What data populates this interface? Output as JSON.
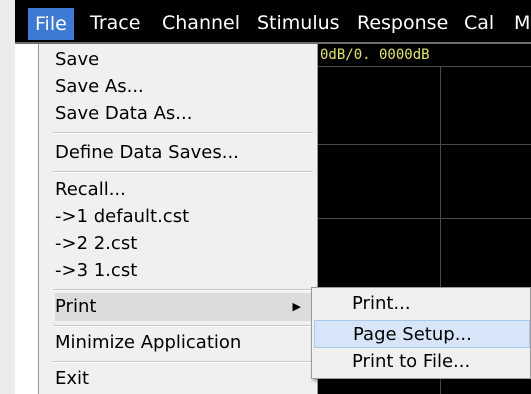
{
  "menubar": {
    "items": [
      {
        "label": "File",
        "active": true
      },
      {
        "label": "Trace"
      },
      {
        "label": "Channel"
      },
      {
        "label": "Stimulus"
      },
      {
        "label": "Response"
      },
      {
        "label": "Cal"
      },
      {
        "label": "M"
      }
    ],
    "active_color": "#3c7ad6"
  },
  "graph": {
    "trace_label": "0dB/0. 0000dB",
    "trace_color": "#e6e65a",
    "background": "#000000"
  },
  "file_menu": {
    "items": [
      {
        "label": "Save"
      },
      {
        "label": "Save As..."
      },
      {
        "label": "Save Data As..."
      },
      {
        "label": "Define Data Saves..."
      },
      {
        "label": "Recall..."
      },
      {
        "label": "->1 default.cst"
      },
      {
        "label": "->2 2.cst"
      },
      {
        "label": "->3 1.cst"
      },
      {
        "label": "Print",
        "submenu": true,
        "arrow": "▶"
      },
      {
        "label": "Minimize Application"
      },
      {
        "label": "Exit"
      }
    ]
  },
  "print_submenu": {
    "items": [
      {
        "label": "Print..."
      },
      {
        "label": "Page Setup..."
      },
      {
        "label": "Print to File..."
      }
    ],
    "hovered_index": 1
  }
}
